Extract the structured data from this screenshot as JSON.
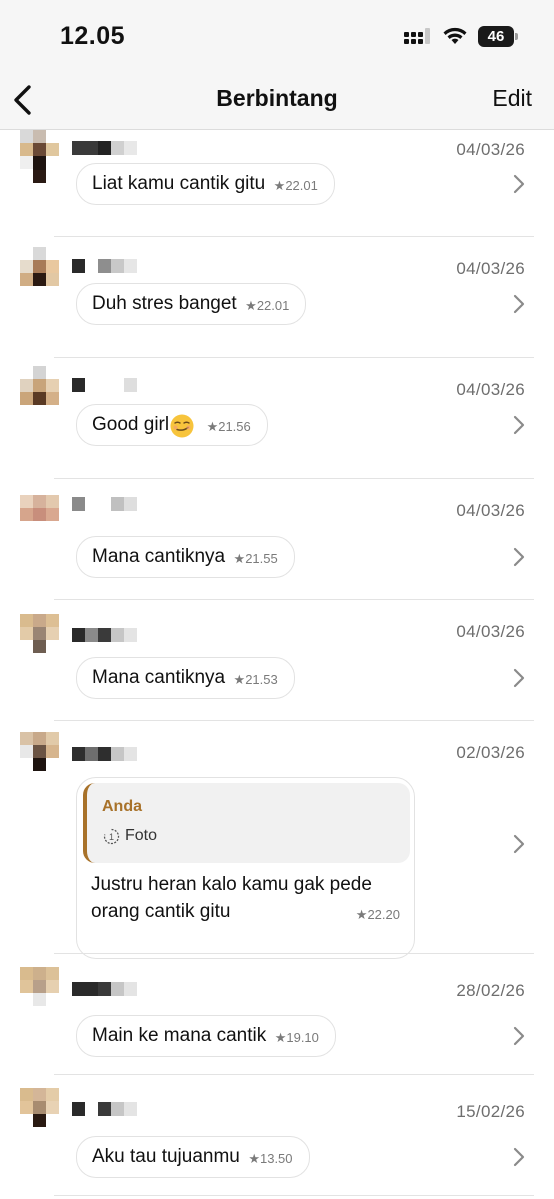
{
  "status": {
    "time": "12.05",
    "battery": "46"
  },
  "nav": {
    "title": "Berbintang",
    "edit_label": "Edit",
    "back_icon": "chevron-left-icon"
  },
  "colors": {
    "quote_accent": "#a8722a",
    "background": "#ffffff",
    "nav_background": "#f6f6f6"
  },
  "messages": [
    {
      "date": "04/03/26",
      "text": "Liat kamu cantik gitu",
      "time": "22.01",
      "starred": true
    },
    {
      "date": "04/03/26",
      "text": "Duh stres banget",
      "time": "22.01",
      "starred": true
    },
    {
      "date": "04/03/26",
      "text": "Good girl",
      "emoji": "smirking-face",
      "time": "21.56",
      "starred": true
    },
    {
      "date": "04/03/26",
      "text": "Mana cantiknya",
      "time": "21.55",
      "starred": true
    },
    {
      "date": "04/03/26",
      "text": "Mana cantiknya",
      "time": "21.53",
      "starred": true
    },
    {
      "date": "02/03/26",
      "quote": {
        "sender": "Anda",
        "label": "Foto",
        "icon": "view-once-photo-icon"
      },
      "text": "Justru heran kalo kamu gak pede orang cantik gitu",
      "time": "22.20",
      "starred": true
    },
    {
      "date": "28/02/26",
      "text": "Main ke mana cantik",
      "time": "19.10",
      "starred": true
    },
    {
      "date": "15/02/26",
      "text": "Aku tau tujuanmu",
      "time": "13.50",
      "starred": true
    }
  ]
}
